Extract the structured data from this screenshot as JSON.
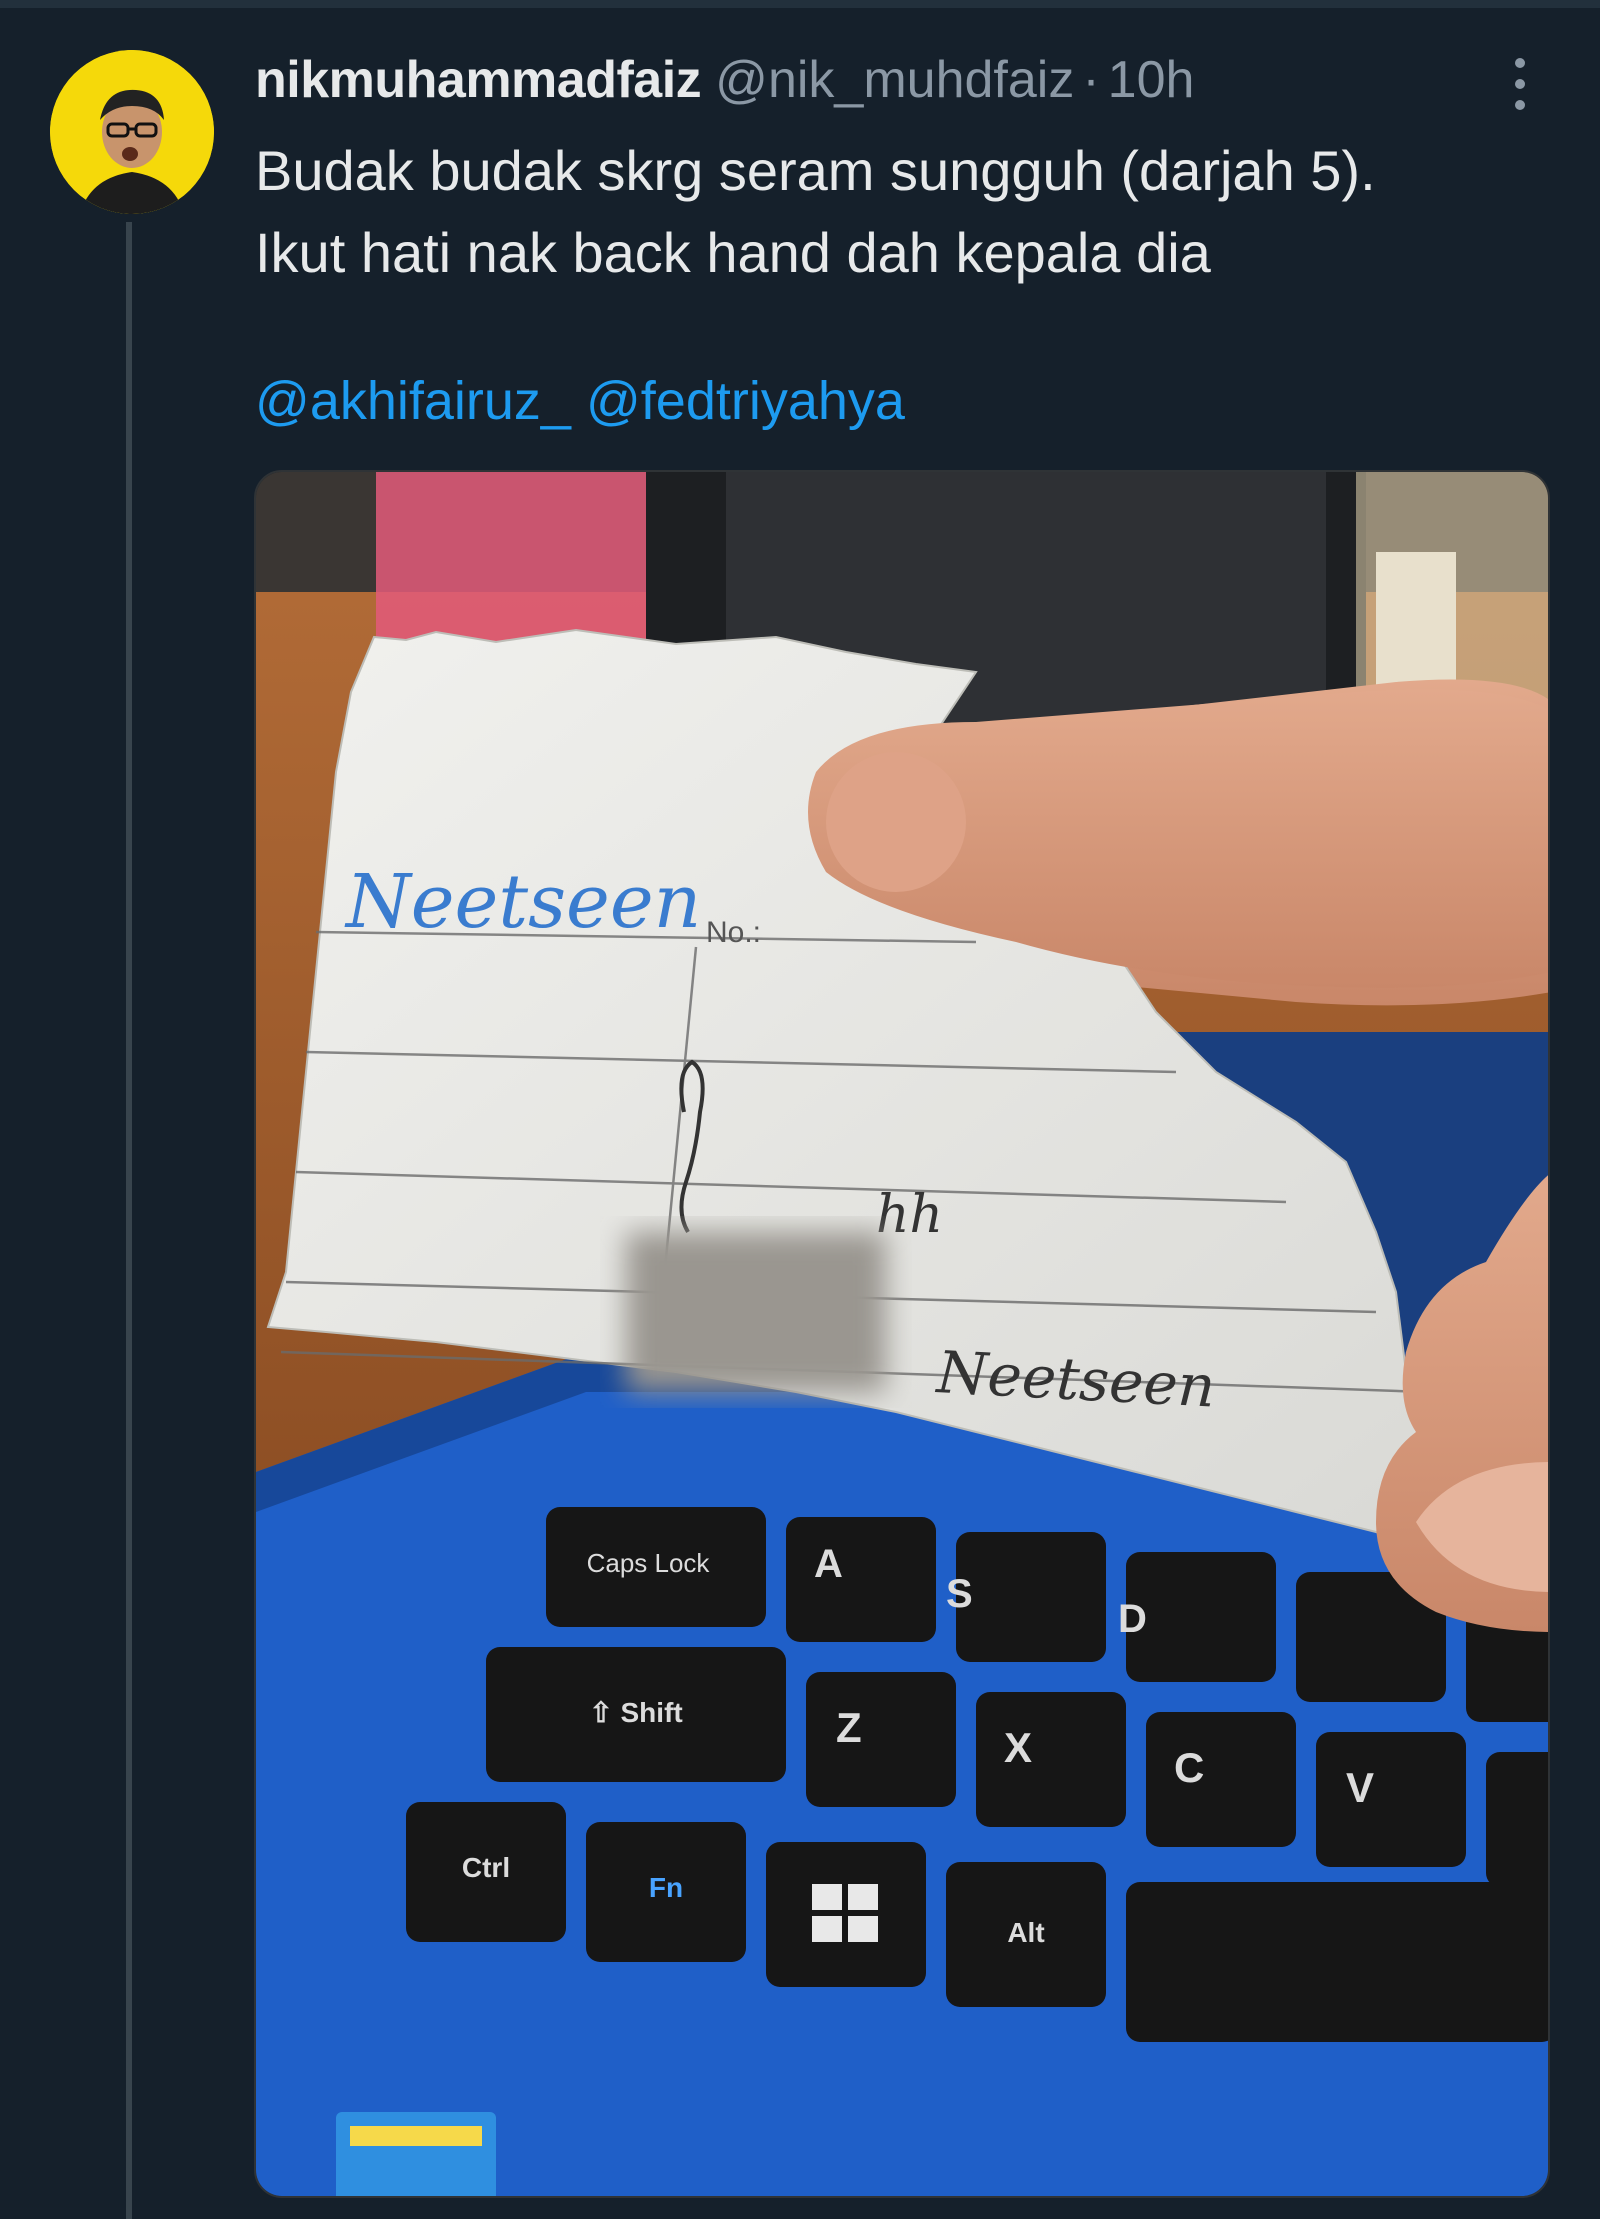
{
  "tweet": {
    "display_name": "nikmuhammadfaiz",
    "handle": "@nik_muhdfaiz",
    "separator": "·",
    "time": "10h",
    "text_lines": [
      "Budak budak skrg seram sungguh (darjah 5).",
      "Ikut hati nak back hand dah kepala dia"
    ],
    "mentions": [
      "@akhifairuz_",
      "@fedtriyahya"
    ],
    "more_icon": "more-vertical-icon"
  },
  "photo": {
    "paper": {
      "scribble_top": "Neetseen",
      "no_label": "No.:",
      "handwriting_mid": "hh",
      "handwriting_bottom": "Neetseen"
    },
    "keys": {
      "caps_lock": "Caps Lock",
      "a": "A",
      "s": "S",
      "d": "D",
      "shift": "⇧ Shift",
      "z": "Z",
      "x": "X",
      "c": "C",
      "v": "V",
      "ctrl": "Ctrl",
      "fn": "Fn",
      "alt": "Alt"
    }
  },
  "colors": {
    "background": "#15202b",
    "text": "#e7e9ea",
    "secondary": "#8b98a5",
    "link": "#1d9bf0",
    "avatar_bg": "#f5d90a",
    "laptop_blue": "#1f5fc8"
  }
}
